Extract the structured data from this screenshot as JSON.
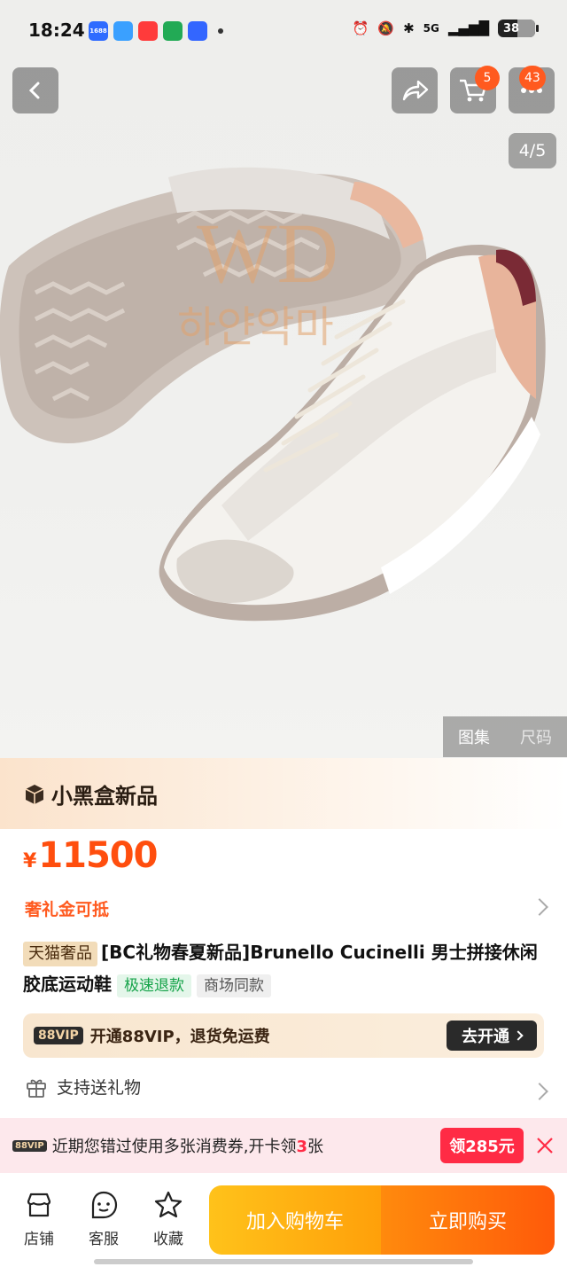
{
  "status_bar": {
    "time": "18:24",
    "apps": [
      {
        "name": "1688-app-icon",
        "label": "1688",
        "color": "#2f6bff"
      },
      {
        "name": "app-icon-2",
        "label": "",
        "color": "#3aa0ff"
      },
      {
        "name": "app-icon-3",
        "label": "",
        "color": "#ff3b3b"
      },
      {
        "name": "app-icon-4",
        "label": "",
        "color": "#22aa55"
      },
      {
        "name": "baidu-icon",
        "label": "",
        "color": "#3366ff"
      }
    ],
    "network": "5G",
    "battery": "38"
  },
  "hero": {
    "cart_count": "5",
    "more_count": "43",
    "pager": "4/5",
    "watermark_top": "WD",
    "watermark_bottom": "하얀악마",
    "gallery_tabs": [
      "图集",
      "尺码"
    ]
  },
  "product": {
    "channel": "小黑盒新品",
    "currency": "¥",
    "price": "11500",
    "gift_credit": "奢礼金可抵",
    "tag_tmall": "天猫奢品",
    "title": "[BC礼物春夏新品]Brunello Cucinelli 男士拼接休闲胶底运动鞋",
    "tag_refund": "极速退款",
    "tag_mall": "商场同款"
  },
  "vip": {
    "badge": "88VIP",
    "text": "开通88VIP，退货免运费",
    "button": "去开通"
  },
  "gift": {
    "label": "支持送礼物"
  },
  "coupon": {
    "badge": "88VIP",
    "text_before": "近期您错过使用多张消费券,开卡领",
    "count": "3",
    "text_after": "张",
    "button": "领285元"
  },
  "bottom": {
    "store": "店铺",
    "service": "客服",
    "favorite": "收藏",
    "add_cart": "加入购物车",
    "buy_now": "立即购买"
  },
  "colors": {
    "accent": "#ff5a1f",
    "price": "#ff4e0e",
    "coupon": "#ff2b45",
    "cart_button": "#ffb010",
    "buy_button": "#ff6a0c"
  }
}
